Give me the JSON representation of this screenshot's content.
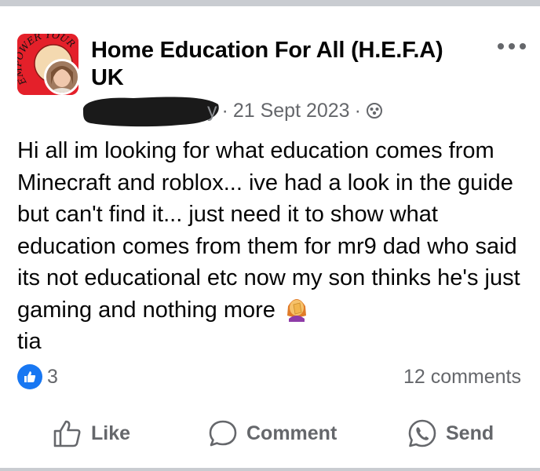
{
  "post": {
    "group_name": "Home Education For All (H.E.F.A) UK",
    "avatar_text": "EMPOWER YOUR",
    "meta_partial": "y",
    "date": "21 Sept 2023",
    "separator": "·",
    "text": "Hi all im looking for what education comes from Minecraft and roblox... ive had a look in the guide but can't find it... just need it to show what education comes from them for mr9 dad who said its not educational etc now my son thinks he's just gaming and nothing more",
    "text_end": "tia",
    "emoji": "woman-facepalming-emoji"
  },
  "stats": {
    "reaction_count": "3",
    "comments": "12 comments"
  },
  "actions": {
    "like": "Like",
    "comment": "Comment",
    "send": "Send"
  },
  "colors": {
    "facebook_blue": "#1877f2",
    "secondary_text": "#65676b",
    "group_avatar_red": "#e4202a"
  }
}
